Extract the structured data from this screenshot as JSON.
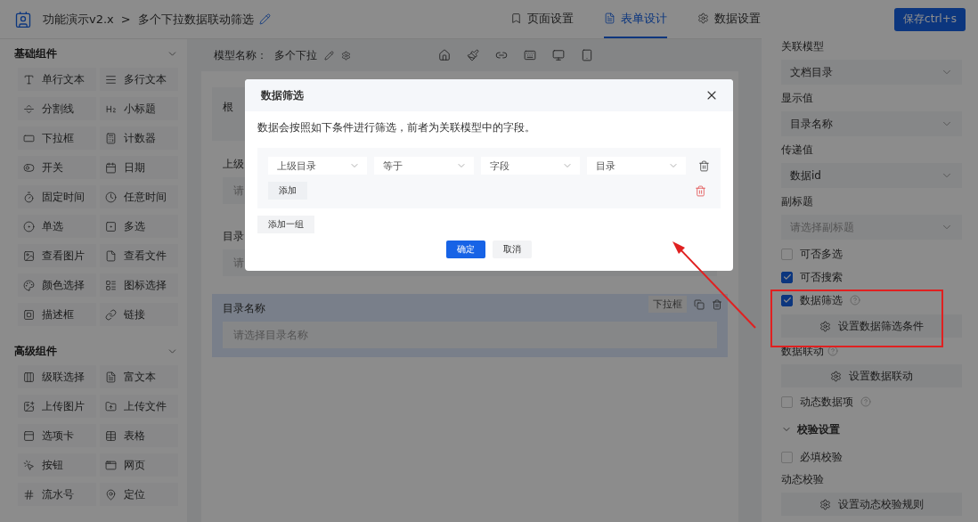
{
  "header": {
    "app_title": "功能演示v2.x",
    "separator": ">",
    "page_title": "多个下拉数据联动筛选",
    "save_button": "保存ctrl+s"
  },
  "tabs": [
    {
      "label": "页面设置",
      "selected": false
    },
    {
      "label": "表单设计",
      "selected": true
    },
    {
      "label": "数据设置",
      "selected": false
    }
  ],
  "sidebar": {
    "groups": [
      {
        "title": "基础组件",
        "expanded": true,
        "items": [
          "单行文本",
          "多行文本",
          "分割线",
          "小标题",
          "下拉框",
          "计数器",
          "开关",
          "日期",
          "固定时间",
          "任意时间",
          "单选",
          "多选",
          "查看图片",
          "查看文件",
          "颜色选择",
          "图标选择",
          "描述框",
          "链接"
        ]
      },
      {
        "title": "高级组件",
        "expanded": true,
        "items": [
          "级联选择",
          "富文本",
          "上传图片",
          "上传文件",
          "选项卡",
          "表格",
          "按钮",
          "网页",
          "流水号",
          "定位"
        ]
      }
    ]
  },
  "canvas": {
    "model_label": "模型名称：",
    "model_name": "多个下拉",
    "fields": [
      {
        "kind": "note",
        "text": "根"
      },
      {
        "kind": "select",
        "label": "上级",
        "placeholder": "请",
        "selected": false
      },
      {
        "kind": "select",
        "label": "目录",
        "placeholder": "请",
        "selected": false
      },
      {
        "kind": "select",
        "label": "目录名称",
        "placeholder": "请选择目录名称",
        "selected": true,
        "type_tag": "下拉框"
      }
    ]
  },
  "properties": [
    {
      "kind": "select",
      "label": "关联模型",
      "value": "文档目录"
    },
    {
      "kind": "select",
      "label": "显示值",
      "value": "目录名称"
    },
    {
      "kind": "select",
      "label": "传递值",
      "value": "数据id"
    },
    {
      "kind": "select",
      "label": "副标题",
      "placeholder": "请选择副标题"
    },
    {
      "kind": "checkbox",
      "label": "可否多选",
      "checked": false,
      "help": false
    },
    {
      "kind": "checkbox",
      "label": "可否搜索",
      "checked": true,
      "help": false
    },
    {
      "kind": "checkbox",
      "label": "数据筛选",
      "checked": true,
      "help": true
    },
    {
      "kind": "button",
      "label": "设置数据筛选条件"
    },
    {
      "kind": "label",
      "label": "数据联动",
      "help": true
    },
    {
      "kind": "button",
      "label": "设置数据联动"
    },
    {
      "kind": "checkbox",
      "label": "动态数据项",
      "checked": false,
      "help": true
    },
    {
      "kind": "section",
      "label": "校验设置",
      "expanded": true
    },
    {
      "kind": "checkbox",
      "label": "必填校验",
      "checked": false,
      "help": false
    },
    {
      "kind": "label",
      "label": "动态校验",
      "help": false
    },
    {
      "kind": "button",
      "label": "设置动态校验规则"
    }
  ],
  "modal": {
    "title": "数据筛选",
    "description": "数据会按照如下条件进行筛选，前者为关联模型中的字段。",
    "groups": [
      {
        "conditions": [
          {
            "field": "上级目录",
            "operator": "等于",
            "value_type": "字段",
            "value": "目录"
          }
        ],
        "add_button": "添加"
      }
    ],
    "add_group_button": "添加一组",
    "confirm_button": "确定",
    "cancel_button": "取消"
  }
}
